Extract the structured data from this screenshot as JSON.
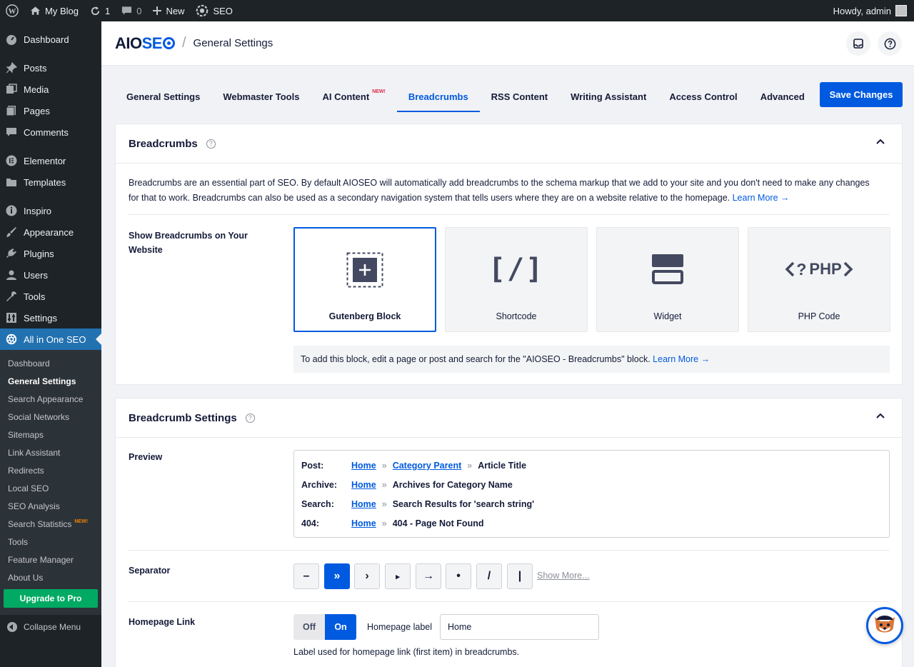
{
  "adminbar": {
    "site_name": "My Blog",
    "updates_count": "1",
    "comments_count": "0",
    "new_label": "New",
    "seo_label": "SEO",
    "howdy": "Howdy, admin"
  },
  "sidebar": {
    "items": [
      {
        "label": "Dashboard",
        "icon": "dashboard-icon"
      },
      {
        "label": "Posts",
        "icon": "pin-icon"
      },
      {
        "label": "Media",
        "icon": "media-icon"
      },
      {
        "label": "Pages",
        "icon": "page-icon"
      },
      {
        "label": "Comments",
        "icon": "comment-icon"
      },
      {
        "label": "Elementor",
        "icon": "elementor-icon"
      },
      {
        "label": "Templates",
        "icon": "folder-icon"
      },
      {
        "label": "Inspiro",
        "icon": "inspiro-icon"
      },
      {
        "label": "Appearance",
        "icon": "brush-icon"
      },
      {
        "label": "Plugins",
        "icon": "plug-icon"
      },
      {
        "label": "Users",
        "icon": "user-icon"
      },
      {
        "label": "Tools",
        "icon": "wrench-icon"
      },
      {
        "label": "Settings",
        "icon": "settings-icon"
      },
      {
        "label": "All in One SEO",
        "icon": "aioseo-icon"
      }
    ],
    "submenu": [
      {
        "label": "Dashboard"
      },
      {
        "label": "General Settings"
      },
      {
        "label": "Search Appearance"
      },
      {
        "label": "Social Networks"
      },
      {
        "label": "Sitemaps"
      },
      {
        "label": "Link Assistant"
      },
      {
        "label": "Redirects"
      },
      {
        "label": "Local SEO"
      },
      {
        "label": "SEO Analysis"
      },
      {
        "label": "Search Statistics",
        "badge": "NEW!"
      },
      {
        "label": "Tools"
      },
      {
        "label": "Feature Manager"
      },
      {
        "label": "About Us"
      }
    ],
    "upgrade_label": "Upgrade to Pro",
    "collapse_label": "Collapse Menu"
  },
  "header": {
    "logo_aio": "AIO",
    "logo_seo": "SE",
    "separator": "/",
    "title": "General Settings"
  },
  "tabs": [
    {
      "label": "General Settings"
    },
    {
      "label": "Webmaster Tools"
    },
    {
      "label": "AI Content",
      "badge": "NEW!"
    },
    {
      "label": "Breadcrumbs"
    },
    {
      "label": "RSS Content"
    },
    {
      "label": "Writing Assistant"
    },
    {
      "label": "Access Control"
    },
    {
      "label": "Advanced"
    }
  ],
  "save_label": "Save Changes",
  "breadcrumbs_card": {
    "title": "Breadcrumbs",
    "description": "Breadcrumbs are an essential part of SEO. By default AIOSEO will automatically add breadcrumbs to the schema markup that we add to your site and you don't need to make any changes for that to work. Breadcrumbs can also be used as a secondary navigation system that tells users where they are on a website relative to the homepage.",
    "learn_more": "Learn More →",
    "show_label": "Show Breadcrumbs on Your Website",
    "options": [
      {
        "label": "Gutenberg Block",
        "icon": "gutenberg-block-icon"
      },
      {
        "label": "Shortcode",
        "icon": "shortcode-icon"
      },
      {
        "label": "Widget",
        "icon": "widget-icon"
      },
      {
        "label": "PHP Code",
        "icon": "php-code-icon"
      }
    ],
    "shortcode_glyph": "[/]",
    "php_glyph": "PHP",
    "note": "To add this block, edit a page or post and search for the \"AIOSEO - Breadcrumbs\" block.",
    "note_link": "Learn More →"
  },
  "settings_card": {
    "title": "Breadcrumb Settings",
    "preview_label": "Preview",
    "preview": {
      "post_key": "Post:",
      "archive_key": "Archive:",
      "search_key": "Search:",
      "notfound_key": "404:",
      "home": "Home",
      "sep": "»",
      "category_parent": "Category Parent",
      "article_title": "Article Title",
      "archive_text": "Archives for Category Name",
      "search_text": "Search Results for 'search string'",
      "notfound_text": "404 - Page Not Found"
    },
    "separator_label": "Separator",
    "separators": [
      "–",
      "»",
      "›",
      "▸",
      "→",
      "•",
      "/",
      "|"
    ],
    "show_more": "Show More...",
    "homepage_link_label": "Homepage Link",
    "toggle_off": "Off",
    "toggle_on": "On",
    "homepage_label_text": "Homepage label",
    "homepage_label_value": "Home",
    "homepage_help": "Label used for homepage link (first item) in breadcrumbs."
  },
  "colors": {
    "accent": "#005ae0",
    "wp_dark": "#1d2327",
    "wp_blue": "#2271b1",
    "upgrade_green": "#00aa63"
  }
}
